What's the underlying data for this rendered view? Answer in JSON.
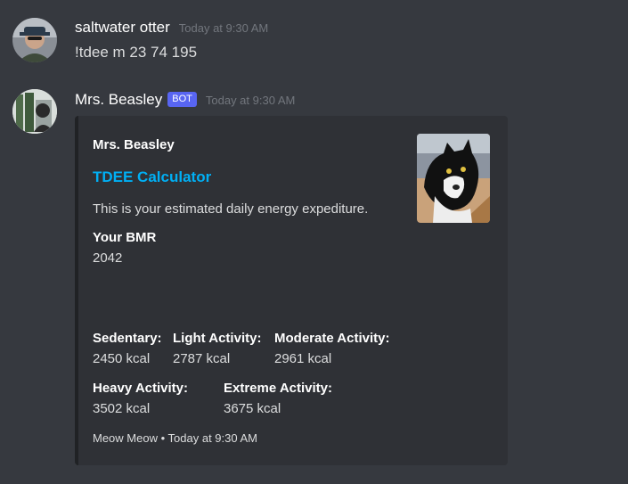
{
  "messages": [
    {
      "author": "saltwater otter",
      "timestamp": "Today at 9:30 AM",
      "content": "!tdee m 23 74 195"
    },
    {
      "author": "Mrs. Beasley",
      "badge": "BOT",
      "timestamp": "Today at 9:30 AM"
    }
  ],
  "embed": {
    "author": "Mrs. Beasley",
    "title": "TDEE Calculator",
    "description": "This is your estimated daily energy expediture.",
    "fields": [
      {
        "name": "Your BMR",
        "value": "2042"
      },
      {
        "name": "Sedentary:",
        "value": "2450 kcal"
      },
      {
        "name": "Light Activity:",
        "value": "2787 kcal"
      },
      {
        "name": "Moderate Activity:",
        "value": "2961 kcal"
      },
      {
        "name": "Heavy Activity:",
        "value": "3502 kcal"
      },
      {
        "name": "Extreme Activity:",
        "value": "3675 kcal"
      }
    ],
    "footer": {
      "text": "Meow Meow",
      "separator": "•",
      "timestamp": "Today at 9:30 AM"
    }
  },
  "colors": {
    "background": "#36393f",
    "embed_background": "#2f3136",
    "embed_border": "#202225",
    "link": "#00aff4",
    "bot_badge": "#5865f2"
  }
}
